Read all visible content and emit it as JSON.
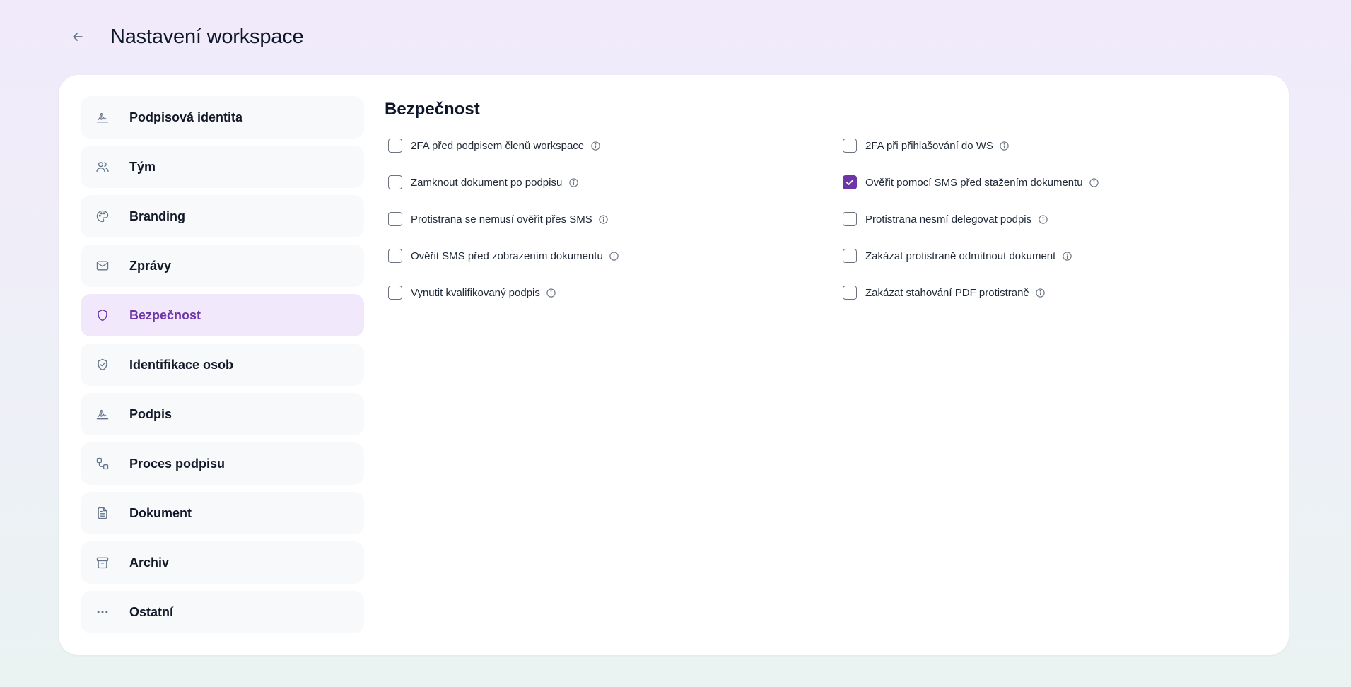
{
  "header": {
    "title": "Nastavení workspace",
    "back_icon": "arrow-left-icon"
  },
  "colors": {
    "accent": "#6d35a8",
    "active_bg": "#f1e8fb",
    "nav_bg": "#f8f9fb"
  },
  "sidebar": {
    "items": [
      {
        "label": "Podpisová identita",
        "icon": "signature-icon",
        "active": false
      },
      {
        "label": "Tým",
        "icon": "users-icon",
        "active": false
      },
      {
        "label": "Branding",
        "icon": "palette-icon",
        "active": false
      },
      {
        "label": "Zprávy",
        "icon": "mail-icon",
        "active": false
      },
      {
        "label": "Bezpečnost",
        "icon": "shield-icon",
        "active": true
      },
      {
        "label": "Identifikace osob",
        "icon": "shield-check-icon",
        "active": false
      },
      {
        "label": "Podpis",
        "icon": "signature-icon",
        "active": false
      },
      {
        "label": "Proces podpisu",
        "icon": "workflow-icon",
        "active": false
      },
      {
        "label": "Dokument",
        "icon": "document-icon",
        "active": false
      },
      {
        "label": "Archiv",
        "icon": "archive-icon",
        "active": false
      },
      {
        "label": "Ostatní",
        "icon": "more-horizontal-icon",
        "active": false
      }
    ]
  },
  "main": {
    "section_title": "Bezpečnost",
    "options": [
      {
        "label": "2FA před podpisem členů workspace",
        "checked": false
      },
      {
        "label": "2FA při přihlašování do WS",
        "checked": false
      },
      {
        "label": "Zamknout dokument po podpisu",
        "checked": false
      },
      {
        "label": "Ověřit pomocí SMS před stažením dokumentu",
        "checked": true
      },
      {
        "label": "Protistrana se nemusí ověřit přes SMS",
        "checked": false
      },
      {
        "label": "Protistrana nesmí delegovat podpis",
        "checked": false
      },
      {
        "label": "Ověřit SMS před zobrazením dokumentu",
        "checked": false
      },
      {
        "label": "Zakázat protistraně odmítnout dokument",
        "checked": false
      },
      {
        "label": "Vynutit kvalifikovaný podpis",
        "checked": false
      },
      {
        "label": "Zakázat stahování PDF protistraně",
        "checked": false
      }
    ]
  }
}
